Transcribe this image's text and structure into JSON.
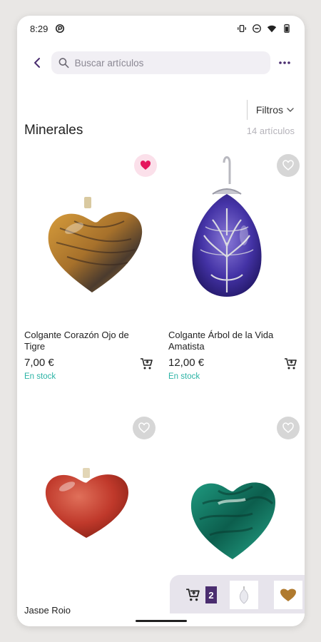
{
  "status_bar": {
    "time": "8:29"
  },
  "search": {
    "placeholder": "Buscar artículos"
  },
  "filters": {
    "label": "Filtros"
  },
  "section": {
    "title": "Minerales",
    "count": "14 artículos"
  },
  "products": [
    {
      "name": "Colgante Corazón Ojo de Tigre",
      "price": "7,00 €",
      "stock": "En stock",
      "favorite": true,
      "image": "tigers-eye-heart-pendant"
    },
    {
      "name": "Colgante Árbol de la Vida Amatista",
      "price": "12,00 €",
      "stock": "En stock",
      "favorite": false,
      "image": "amethyst-tree-of-life-pendant"
    },
    {
      "name": "Jaspe Rojo",
      "favorite": false,
      "image": "red-jasper-heart"
    },
    {
      "favorite": false,
      "image": "malachite-heart"
    }
  ],
  "minicart": {
    "count": "2"
  },
  "colors": {
    "accent": "#4a2d6f",
    "stock": "#2bb3a5",
    "favorite": "#e5175e",
    "search_bg": "#f1eff4"
  }
}
